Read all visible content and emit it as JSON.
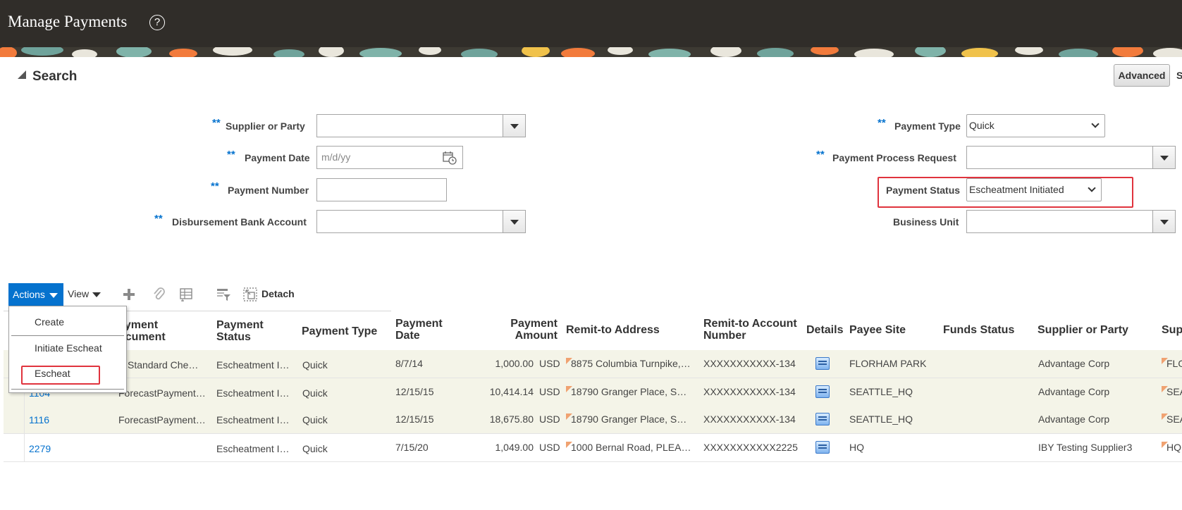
{
  "header": {
    "title": "Manage Payments",
    "help_symbol": "?"
  },
  "search": {
    "title": "Search",
    "advanced_label": "Advanced",
    "saved_search_clip": "S",
    "required_marker": "**",
    "fields": {
      "supplier_or_party": {
        "label": "Supplier or Party",
        "value": ""
      },
      "payment_date": {
        "label": "Payment Date",
        "placeholder": "m/d/yy"
      },
      "payment_number": {
        "label": "Payment Number",
        "value": ""
      },
      "disbursement_bank_account": {
        "label": "Disbursement Bank Account",
        "value": ""
      },
      "payment_type": {
        "label": "Payment Type",
        "value": "Quick"
      },
      "payment_process_request": {
        "label": "Payment Process Request",
        "value": ""
      },
      "payment_status": {
        "label": "Payment Status",
        "value": "Escheatment Initiated"
      },
      "business_unit": {
        "label": "Business Unit",
        "value": ""
      }
    }
  },
  "toolbar": {
    "actions_label": "Actions",
    "view_label": "View",
    "detach_label": "Detach"
  },
  "actions_menu": {
    "items": [
      "Create",
      "Initiate Escheat",
      "Escheat"
    ]
  },
  "table": {
    "columns": {
      "payment_document": "Payment Document",
      "payment_document_visible_line1": "ayment",
      "payment_document_visible_line2": "ocument",
      "payment_status_1": "Payment",
      "payment_status_2": "Status",
      "payment_type": "Payment Type",
      "payment_date_1": "Payment",
      "payment_date_2": "Date",
      "payment_amount_1": "Payment",
      "payment_amount_2": "Amount",
      "remit_to_address": "Remit-to Address",
      "remit_to_account_1": "Remit-to Account",
      "remit_to_account_2": "Number",
      "details": "Details",
      "payee_site": "Payee Site",
      "funds_status": "Funds Status",
      "supplier_or_party": "Supplier or Party",
      "supplier_site_clip": "Sup"
    },
    "rows": [
      {
        "number": "",
        "document": "P Standard Che…",
        "status": "Escheatment I…",
        "type": "Quick",
        "date": "8/7/14",
        "amount": "1,000.00",
        "currency": "USD",
        "address": "8875 Columbia Turnpike,…",
        "account": "XXXXXXXXXXX-134",
        "payee_site": "FLORHAM PARK",
        "funds_status": "",
        "supplier": "Advantage Corp",
        "site_clip": "FLO"
      },
      {
        "number": "1104",
        "document": "ForecastPayment…",
        "status": "Escheatment I…",
        "type": "Quick",
        "date": "12/15/15",
        "amount": "10,414.14",
        "currency": "USD",
        "address": "18790 Granger Place, S…",
        "account": "XXXXXXXXXXX-134",
        "payee_site": "SEATTLE_HQ",
        "funds_status": "",
        "supplier": "Advantage Corp",
        "site_clip": "SEA"
      },
      {
        "number": "1116",
        "document": "ForecastPayment…",
        "status": "Escheatment I…",
        "type": "Quick",
        "date": "12/15/15",
        "amount": "18,675.80",
        "currency": "USD",
        "address": "18790 Granger Place, S…",
        "account": "XXXXXXXXXXX-134",
        "payee_site": "SEATTLE_HQ",
        "funds_status": "",
        "supplier": "Advantage Corp",
        "site_clip": "SEA"
      },
      {
        "number": "2279",
        "document": "",
        "status": "Escheatment I…",
        "type": "Quick",
        "date": "7/15/20",
        "amount": "1,049.00",
        "currency": "USD",
        "address": "1000 Bernal Road, PLEA…",
        "account": "XXXXXXXXXXX2225",
        "payee_site": "HQ",
        "funds_status": "",
        "supplier": "IBY Testing Supplier3",
        "site_clip": "HQ"
      }
    ]
  },
  "colors": {
    "header_bg": "#302d29",
    "accent_blue": "#0572ce",
    "highlight_red": "#e0333d",
    "row_shade": "#f4f4e8"
  }
}
